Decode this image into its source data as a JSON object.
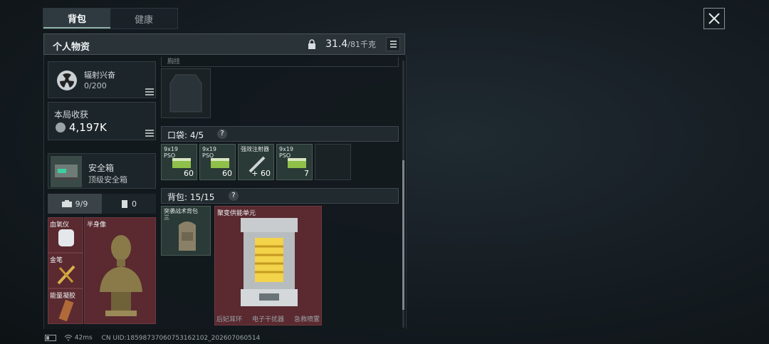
{
  "tabs": [
    {
      "label": "背包"
    },
    {
      "label": "健康"
    }
  ],
  "header": {
    "title": "个人物资",
    "weight_value": "31.4",
    "weight_max": "/81千克"
  },
  "left": {
    "radiation": {
      "label": "辐射兴奋",
      "value": "0/200"
    },
    "income": {
      "label": "本局收获",
      "value": "4,197K"
    },
    "safebox": {
      "title": "安全箱",
      "subtitle": "顶级安全箱"
    },
    "inv_tabs": [
      {
        "label": "9/9"
      },
      {
        "label": "0"
      }
    ],
    "slots": [
      {
        "label": "血氧仪"
      },
      {
        "label": "金笔"
      },
      {
        "label": "能量凝胶"
      }
    ],
    "bust_label": "半身像"
  },
  "right": {
    "top_label": "胸挂",
    "pocket": {
      "label": "口袋: 4/5",
      "q": "?"
    },
    "pocket_items": [
      {
        "line1": "9x19",
        "line2": "PSO",
        "count": "60"
      },
      {
        "line1": "9x19",
        "line2": "PSO",
        "count": "60"
      },
      {
        "line1": "强效注射器",
        "line2": "",
        "count": "60"
      },
      {
        "line1": "9x19",
        "line2": "PSO",
        "count": "7"
      }
    ],
    "backpack": {
      "label": "背包: 15/15",
      "q": "?"
    },
    "backpack_items": [
      {
        "line1": "突袭战术背包",
        "line2": "三"
      },
      {
        "line1": "聚变供能单元",
        "line2": ""
      }
    ],
    "bottom_labels": [
      "后妃耳环",
      "电子干扰器",
      "急救喷雾"
    ]
  },
  "status": {
    "ping": "42ms",
    "uid": "CN UID:18598737060753162102_202607060514"
  },
  "colors": {
    "accent": "#8fb0a8",
    "red_slot": "#5a2a30",
    "green_item": "#2a3a36"
  }
}
